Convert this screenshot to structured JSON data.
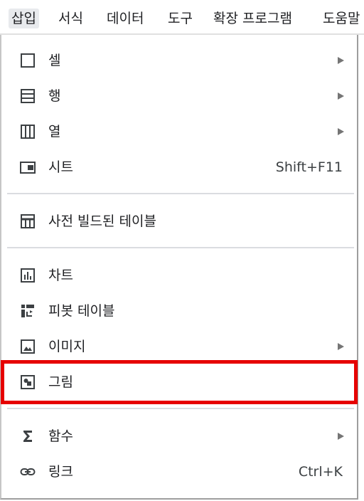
{
  "menubar": {
    "items": [
      "삽입",
      "서식",
      "데이터",
      "도구",
      "확장 프로그램",
      "도움말"
    ]
  },
  "menu": {
    "cell": {
      "label": "셀",
      "icon": "cell-square-icon"
    },
    "row": {
      "label": "행",
      "icon": "row-icon"
    },
    "column": {
      "label": "열",
      "icon": "column-icon"
    },
    "sheet": {
      "label": "시트",
      "icon": "sheet-icon",
      "shortcut": "Shift+F11"
    },
    "prebuilt_table": {
      "label": "사전 빌드된 테이블",
      "icon": "table-icon"
    },
    "chart": {
      "label": "차트",
      "icon": "bar-chart-icon"
    },
    "pivot_table": {
      "label": "피봇 테이블",
      "icon": "pivot-table-icon"
    },
    "image": {
      "label": "이미지",
      "icon": "image-icon"
    },
    "drawing": {
      "label": "그림",
      "icon": "drawing-icon"
    },
    "function": {
      "label": "함수",
      "icon": "sigma-icon"
    },
    "link": {
      "label": "링크",
      "icon": "link-icon",
      "shortcut": "Ctrl+K"
    }
  },
  "colors": {
    "highlight": "#e60000",
    "active_menu_bg": "#e8eaed",
    "text": "#202124",
    "icon": "#3c4043"
  }
}
